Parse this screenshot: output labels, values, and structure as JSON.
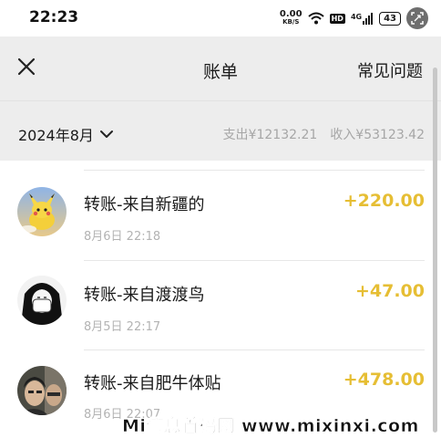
{
  "status_bar": {
    "time": "22:23",
    "net_speed_value": "0.00",
    "net_speed_unit": "KB/S",
    "hd": "HD",
    "signal": "4G",
    "battery": "43"
  },
  "header": {
    "title": "账单",
    "faq_label": "常见问题"
  },
  "filter": {
    "month": "2024年8月",
    "expense": "支出¥12132.21",
    "income": "收入¥53123.42"
  },
  "transactions": [
    {
      "title": "转账-来自新疆的",
      "time": "8月6日 22:18",
      "amount": "+220.00"
    },
    {
      "title": "转账-来自渡渡鸟",
      "time": "8月5日 22:17",
      "amount": "+47.00"
    },
    {
      "title": "转账-来自肥牛体贴",
      "time": "8月6日 22:07",
      "amount": "+478.00"
    }
  ],
  "watermark": "Mi信息首码网 www.mixinxi.com",
  "colors": {
    "amount": "#e6be34",
    "header_bg": "#ededed",
    "muted_text": "#a6a6a6"
  },
  "icons": [
    "close-icon",
    "chevron-down-icon",
    "wifi-icon",
    "signal-icon",
    "screenshot-scan-icon"
  ]
}
